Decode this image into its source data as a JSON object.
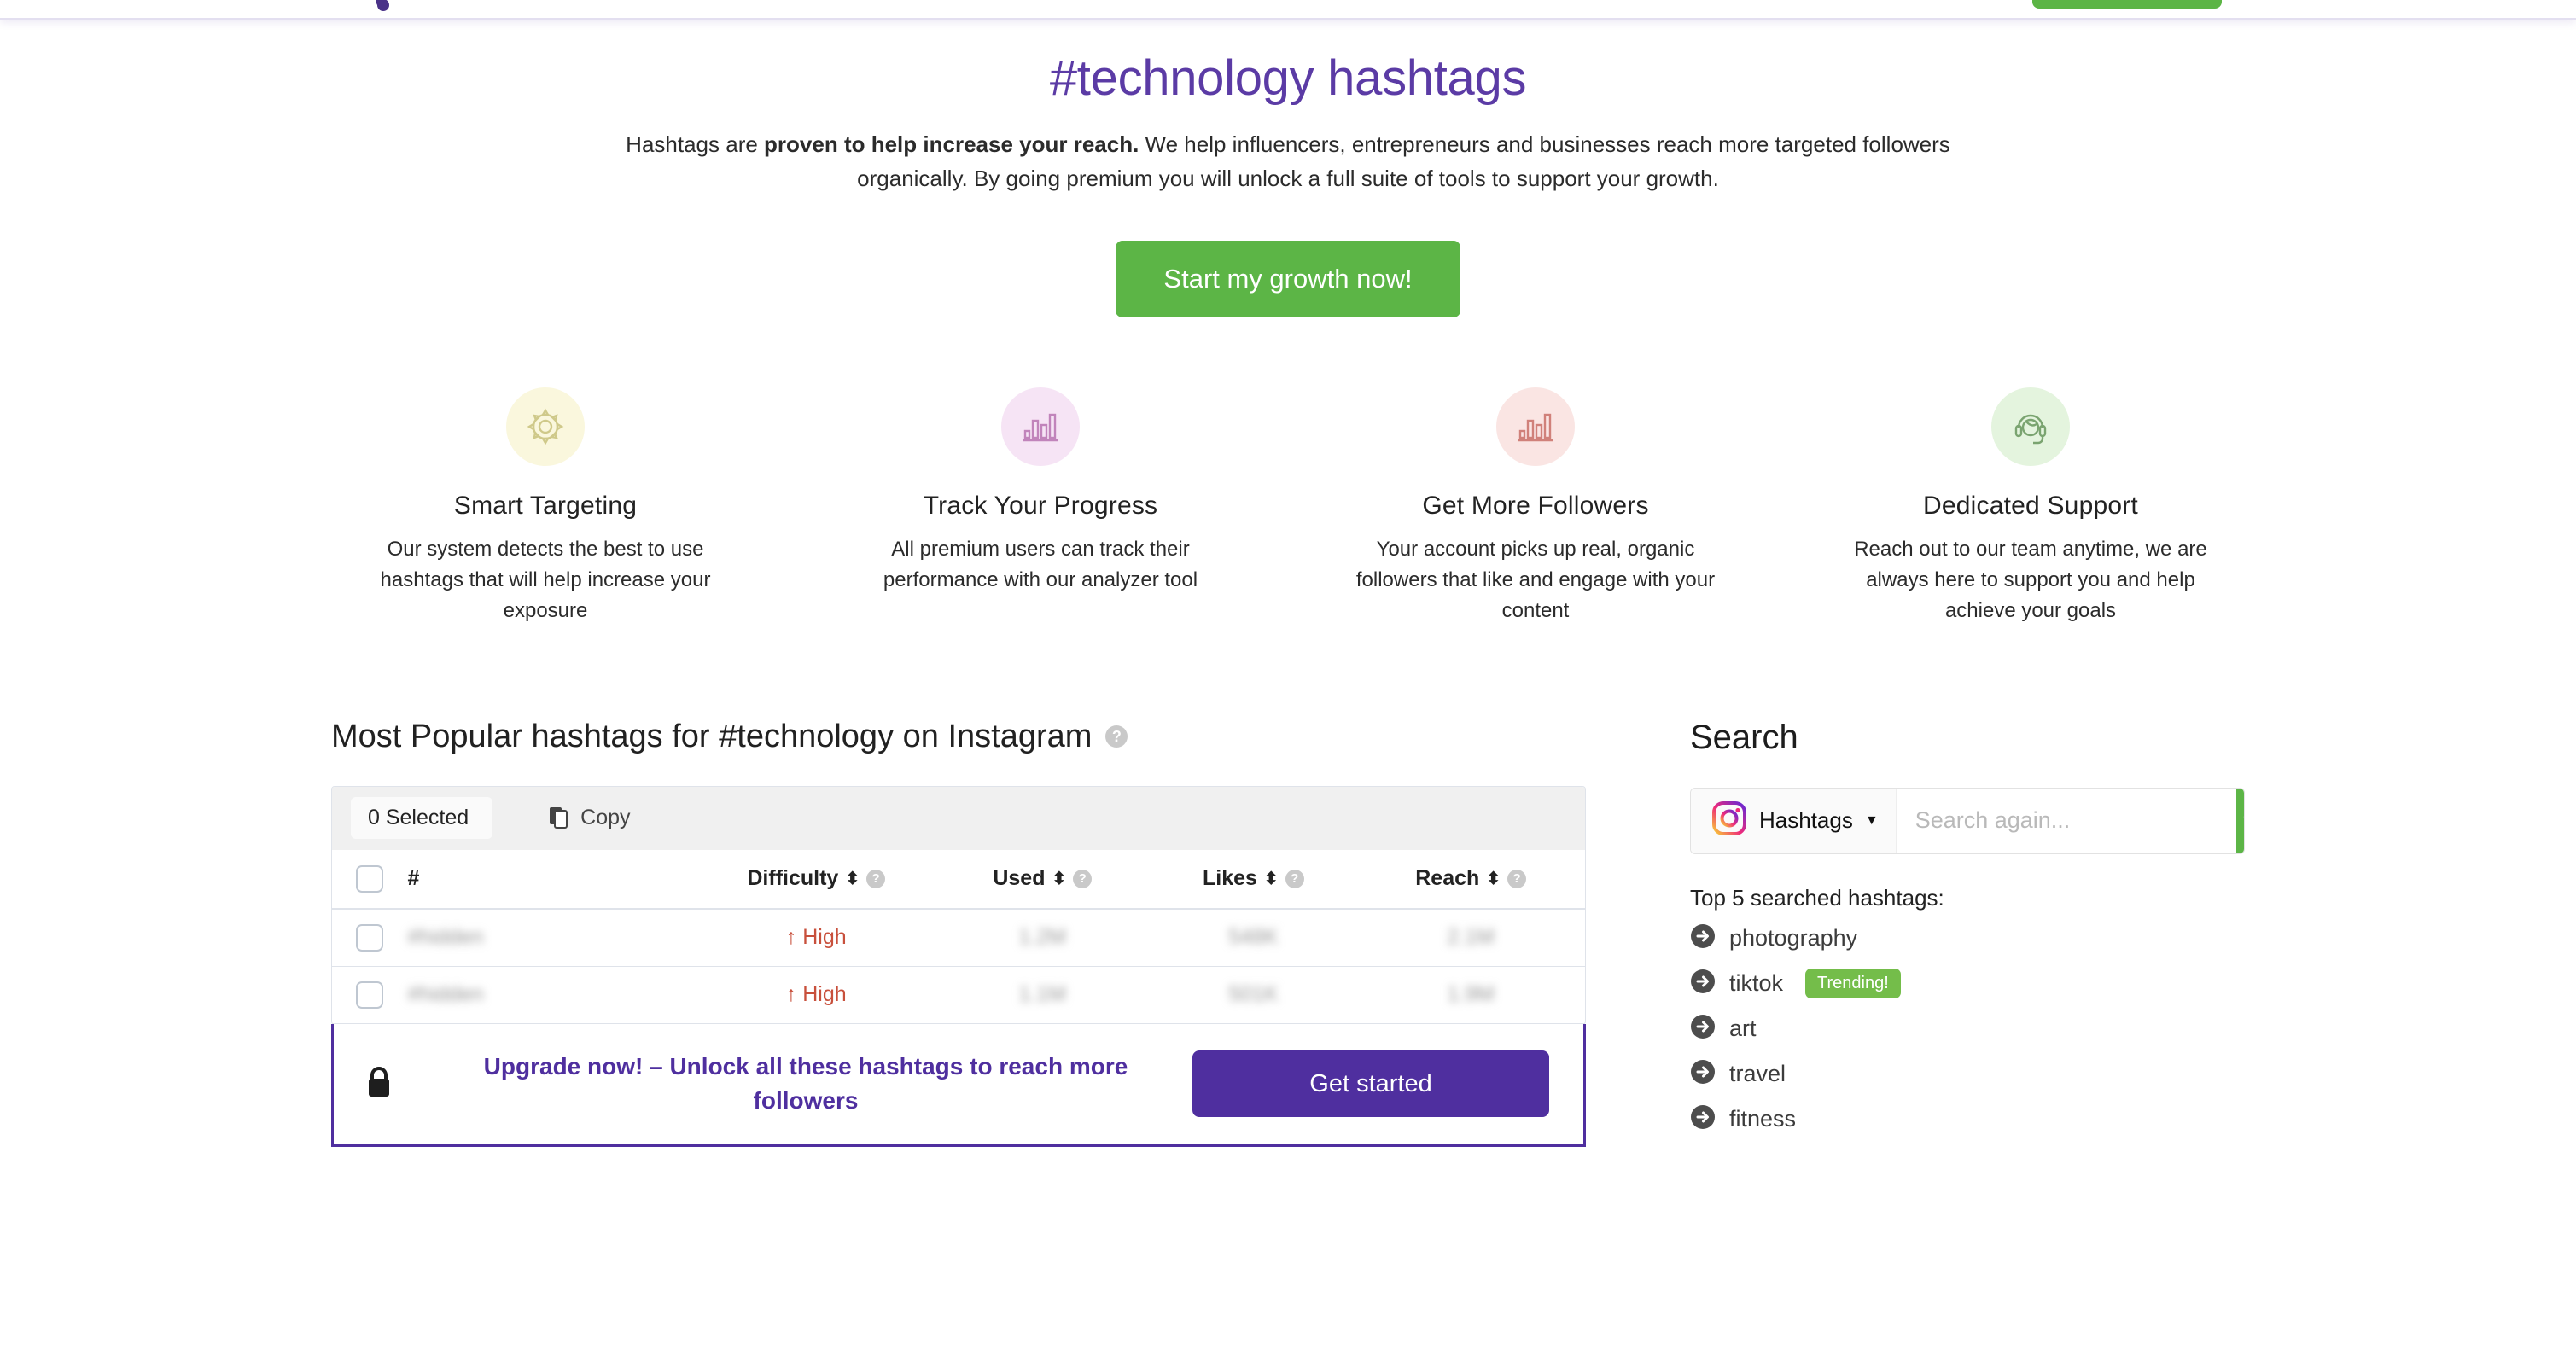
{
  "navbar": {
    "brand_text": "",
    "cta_label": "",
    "logo_icon": "flower-logo-icon"
  },
  "hero": {
    "title": "#technology hashtags",
    "paragraph_lead": "Hashtags are ",
    "paragraph_bold": "proven to help increase your reach.",
    "paragraph_rest": " We help influencers, entrepreneurs and businesses reach more targeted followers organically. By going premium you will unlock a full suite of tools to support your growth.",
    "cta_label": "Start my growth now!"
  },
  "features": [
    {
      "icon": "gear-icon",
      "bg": "#faf7dd",
      "fg": "#cfc98a",
      "title": "Smart Targeting",
      "desc": "Our system detects the best to use hashtags that will help increase your exposure"
    },
    {
      "icon": "bar-chart-icon",
      "bg": "#f6e4f5",
      "fg": "#c184bb",
      "title": "Track Your Progress",
      "desc": "All premium users can track their performance with our analyzer tool"
    },
    {
      "icon": "bar-chart-icon",
      "bg": "#fae5e3",
      "fg": "#d0817a",
      "title": "Get More Followers",
      "desc": "Your account picks up real, organic followers that like and engage with your content"
    },
    {
      "icon": "headset-support-icon",
      "bg": "#e4f4de",
      "fg": "#7aa470",
      "title": "Dedicated Support",
      "desc": "Reach out to our team anytime, we are always here to support you and help achieve your goals"
    }
  ],
  "main": {
    "heading": "Most Popular hashtags for #technology on Instagram",
    "heading_help": "?",
    "toolbar": {
      "selected_label": "0 Selected",
      "copy_label": "Copy"
    },
    "table": {
      "columns": [
        {
          "label": "#",
          "sortable": false,
          "help": false
        },
        {
          "label": "Difficulty",
          "sortable": true,
          "help": true
        },
        {
          "label": "Used",
          "sortable": true,
          "help": true
        },
        {
          "label": "Likes",
          "sortable": true,
          "help": true
        },
        {
          "label": "Reach",
          "sortable": true,
          "help": true
        }
      ],
      "rows": [
        {
          "hashtag": "#hidden",
          "difficulty": "High",
          "difficulty_trend": "up",
          "used": "1.2M",
          "likes": "548K",
          "reach": "2.1M"
        },
        {
          "hashtag": "#hidden",
          "difficulty": "High",
          "difficulty_trend": "up",
          "used": "1.1M",
          "likes": "501K",
          "reach": "1.9M"
        }
      ]
    },
    "upgrade": {
      "icon": "lock-icon",
      "text": "Upgrade now! – Unlock all these hashtags to reach more followers",
      "button_label": "Get started"
    }
  },
  "sidebar": {
    "title": "Search",
    "search": {
      "platform_icon": "instagram-icon",
      "type_label": "Hashtags",
      "caret_icon": "chevron-down-icon",
      "placeholder": "Search again...",
      "value": "",
      "submit_icon": "search-icon"
    },
    "top5_label": "Top 5 searched hashtags:",
    "top5": [
      {
        "name": "photography",
        "badge": ""
      },
      {
        "name": "tiktok",
        "badge": "Trending!"
      },
      {
        "name": "art",
        "badge": ""
      },
      {
        "name": "travel",
        "badge": ""
      },
      {
        "name": "fitness",
        "badge": ""
      }
    ]
  },
  "colors": {
    "brand_purple": "#5b3ba5",
    "deep_purple": "#4f2f9f",
    "green": "#5cb546",
    "badge_green": "#74bd4a",
    "danger_red": "#c8503c"
  }
}
